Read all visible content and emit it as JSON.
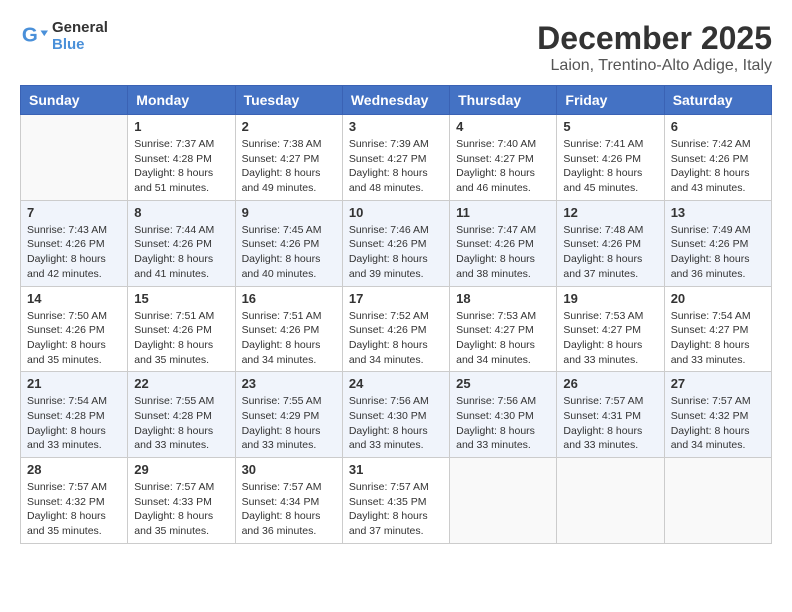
{
  "header": {
    "logo_line1": "General",
    "logo_line2": "Blue",
    "title": "December 2025",
    "subtitle": "Laion, Trentino-Alto Adige, Italy"
  },
  "calendar": {
    "days_of_week": [
      "Sunday",
      "Monday",
      "Tuesday",
      "Wednesday",
      "Thursday",
      "Friday",
      "Saturday"
    ],
    "rows": [
      {
        "shaded": false,
        "cells": [
          {
            "day": "",
            "info": ""
          },
          {
            "day": "1",
            "info": "Sunrise: 7:37 AM\nSunset: 4:28 PM\nDaylight: 8 hours\nand 51 minutes."
          },
          {
            "day": "2",
            "info": "Sunrise: 7:38 AM\nSunset: 4:27 PM\nDaylight: 8 hours\nand 49 minutes."
          },
          {
            "day": "3",
            "info": "Sunrise: 7:39 AM\nSunset: 4:27 PM\nDaylight: 8 hours\nand 48 minutes."
          },
          {
            "day": "4",
            "info": "Sunrise: 7:40 AM\nSunset: 4:27 PM\nDaylight: 8 hours\nand 46 minutes."
          },
          {
            "day": "5",
            "info": "Sunrise: 7:41 AM\nSunset: 4:26 PM\nDaylight: 8 hours\nand 45 minutes."
          },
          {
            "day": "6",
            "info": "Sunrise: 7:42 AM\nSunset: 4:26 PM\nDaylight: 8 hours\nand 43 minutes."
          }
        ]
      },
      {
        "shaded": true,
        "cells": [
          {
            "day": "7",
            "info": "Sunrise: 7:43 AM\nSunset: 4:26 PM\nDaylight: 8 hours\nand 42 minutes."
          },
          {
            "day": "8",
            "info": "Sunrise: 7:44 AM\nSunset: 4:26 PM\nDaylight: 8 hours\nand 41 minutes."
          },
          {
            "day": "9",
            "info": "Sunrise: 7:45 AM\nSunset: 4:26 PM\nDaylight: 8 hours\nand 40 minutes."
          },
          {
            "day": "10",
            "info": "Sunrise: 7:46 AM\nSunset: 4:26 PM\nDaylight: 8 hours\nand 39 minutes."
          },
          {
            "day": "11",
            "info": "Sunrise: 7:47 AM\nSunset: 4:26 PM\nDaylight: 8 hours\nand 38 minutes."
          },
          {
            "day": "12",
            "info": "Sunrise: 7:48 AM\nSunset: 4:26 PM\nDaylight: 8 hours\nand 37 minutes."
          },
          {
            "day": "13",
            "info": "Sunrise: 7:49 AM\nSunset: 4:26 PM\nDaylight: 8 hours\nand 36 minutes."
          }
        ]
      },
      {
        "shaded": false,
        "cells": [
          {
            "day": "14",
            "info": "Sunrise: 7:50 AM\nSunset: 4:26 PM\nDaylight: 8 hours\nand 35 minutes."
          },
          {
            "day": "15",
            "info": "Sunrise: 7:51 AM\nSunset: 4:26 PM\nDaylight: 8 hours\nand 35 minutes."
          },
          {
            "day": "16",
            "info": "Sunrise: 7:51 AM\nSunset: 4:26 PM\nDaylight: 8 hours\nand 34 minutes."
          },
          {
            "day": "17",
            "info": "Sunrise: 7:52 AM\nSunset: 4:26 PM\nDaylight: 8 hours\nand 34 minutes."
          },
          {
            "day": "18",
            "info": "Sunrise: 7:53 AM\nSunset: 4:27 PM\nDaylight: 8 hours\nand 34 minutes."
          },
          {
            "day": "19",
            "info": "Sunrise: 7:53 AM\nSunset: 4:27 PM\nDaylight: 8 hours\nand 33 minutes."
          },
          {
            "day": "20",
            "info": "Sunrise: 7:54 AM\nSunset: 4:27 PM\nDaylight: 8 hours\nand 33 minutes."
          }
        ]
      },
      {
        "shaded": true,
        "cells": [
          {
            "day": "21",
            "info": "Sunrise: 7:54 AM\nSunset: 4:28 PM\nDaylight: 8 hours\nand 33 minutes."
          },
          {
            "day": "22",
            "info": "Sunrise: 7:55 AM\nSunset: 4:28 PM\nDaylight: 8 hours\nand 33 minutes."
          },
          {
            "day": "23",
            "info": "Sunrise: 7:55 AM\nSunset: 4:29 PM\nDaylight: 8 hours\nand 33 minutes."
          },
          {
            "day": "24",
            "info": "Sunrise: 7:56 AM\nSunset: 4:30 PM\nDaylight: 8 hours\nand 33 minutes."
          },
          {
            "day": "25",
            "info": "Sunrise: 7:56 AM\nSunset: 4:30 PM\nDaylight: 8 hours\nand 33 minutes."
          },
          {
            "day": "26",
            "info": "Sunrise: 7:57 AM\nSunset: 4:31 PM\nDaylight: 8 hours\nand 33 minutes."
          },
          {
            "day": "27",
            "info": "Sunrise: 7:57 AM\nSunset: 4:32 PM\nDaylight: 8 hours\nand 34 minutes."
          }
        ]
      },
      {
        "shaded": false,
        "cells": [
          {
            "day": "28",
            "info": "Sunrise: 7:57 AM\nSunset: 4:32 PM\nDaylight: 8 hours\nand 35 minutes."
          },
          {
            "day": "29",
            "info": "Sunrise: 7:57 AM\nSunset: 4:33 PM\nDaylight: 8 hours\nand 35 minutes."
          },
          {
            "day": "30",
            "info": "Sunrise: 7:57 AM\nSunset: 4:34 PM\nDaylight: 8 hours\nand 36 minutes."
          },
          {
            "day": "31",
            "info": "Sunrise: 7:57 AM\nSunset: 4:35 PM\nDaylight: 8 hours\nand 37 minutes."
          },
          {
            "day": "",
            "info": ""
          },
          {
            "day": "",
            "info": ""
          },
          {
            "day": "",
            "info": ""
          }
        ]
      }
    ]
  }
}
